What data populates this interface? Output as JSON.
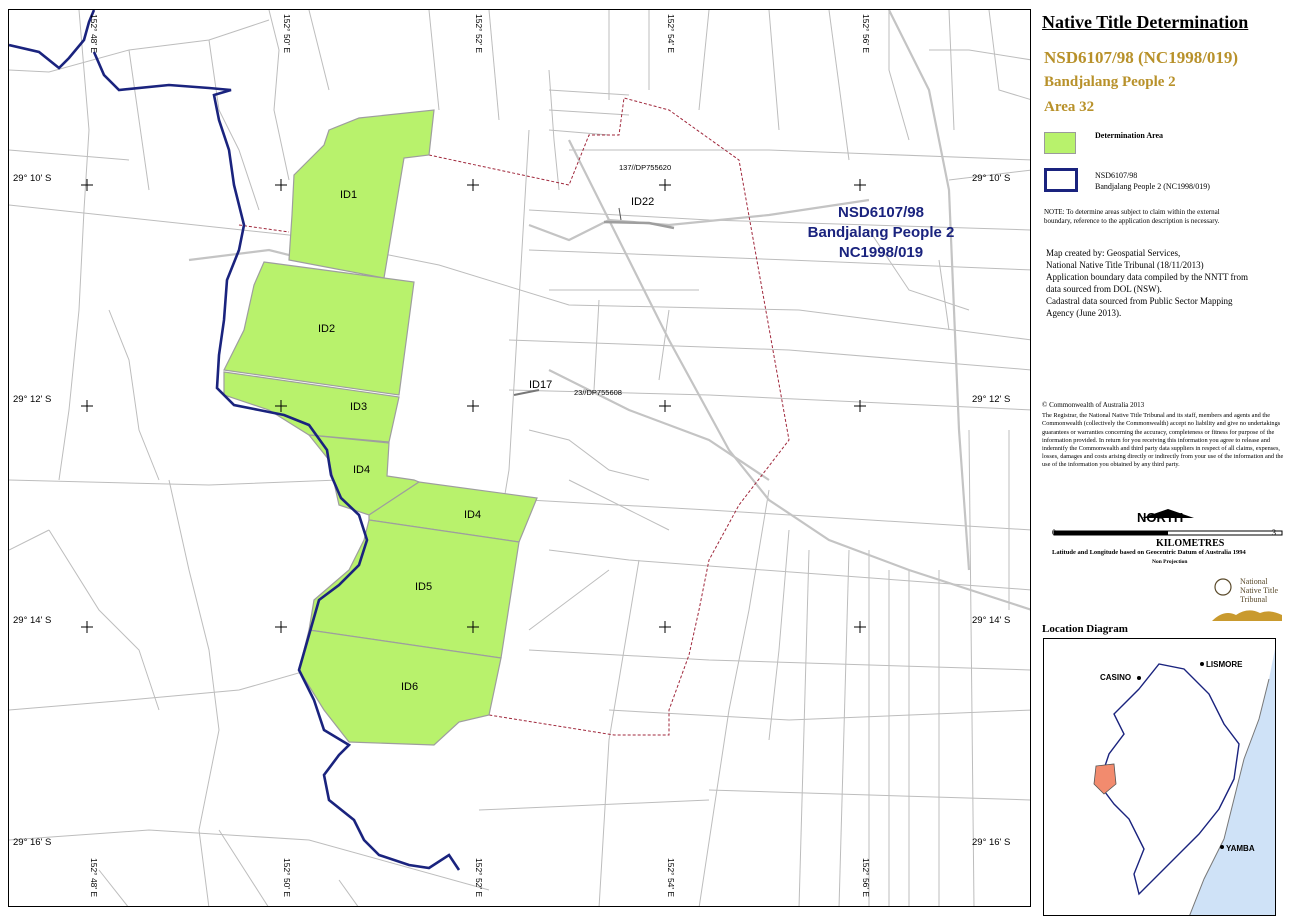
{
  "header": {
    "title": "Native Title Determination",
    "file_number": "NSD6107/98 (NC1998/019)",
    "claim_name": "Bandjalang People 2",
    "area": "Area 32"
  },
  "legend": {
    "determination_area_label": "Determination Area",
    "boundary_label_1": "NSD6107/98",
    "boundary_label_2": "Bandjalang People 2 (NC1998/019)",
    "determination_color": "#b8f26c",
    "boundary_color": "#1a237e"
  },
  "note": {
    "line1": "NOTE: To determine areas subject to claim within the external",
    "line2": "boundary, reference to the application description is necessary."
  },
  "credits": {
    "line1": "Map created by: Geospatial Services,",
    "line2": "National Native Title Tribunal   (18/11/2013)",
    "line3": "Application boundary data compiled by the NNTT from",
    "line4": "data sourced from DOL (NSW).",
    "line5": "Cadastral data sourced from Public Sector Mapping",
    "line6": "Agency (June 2013)."
  },
  "legal": {
    "copyright": "© Commonwealth of Australia 2013",
    "disclaimer": "The Registrar, the National Native Title Tribunal and its staff, members and agents and the Commonwealth (collectively the Commonwealth) accept no liability and give no undertakings guarantees or warranties concerning the accuracy, completeness or fitness for purpose of the information provided. In return for you receiving this information you agree to release and indemnify the Commonwealth and third party data suppliers in respect of all claims, expenses, losses, damages and costs arising directly or indirectly from your use of the information and the use of the information you obtained by any third party."
  },
  "scale": {
    "north": "NORTH",
    "start": "0",
    "end": "3",
    "units": "KILOMETRES",
    "datum": "Latitude and Longitude based on Geocentric Datum of Australia 1994",
    "projection": "Non Projection"
  },
  "nntt_logo": {
    "line1": "National",
    "line2": "Native Title",
    "line3": "Tribunal"
  },
  "location_diagram": {
    "title": "Location Diagram",
    "towns": [
      "LISMORE",
      "CASINO",
      "YAMBA"
    ]
  },
  "map": {
    "claim_label": [
      "NSD6107/98",
      "Bandjalang People 2",
      "NC1998/019"
    ],
    "areas": [
      "ID1",
      "ID2",
      "ID3",
      "ID4",
      "ID4",
      "ID5",
      "ID6"
    ],
    "other_ids": [
      "ID22",
      "ID17"
    ],
    "parcels": [
      "137//DP755620",
      "23//DP755608"
    ],
    "lat_labels": [
      "29° 10' S",
      "29° 12' S",
      "29° 14' S",
      "29° 16' S"
    ],
    "lon_labels": [
      "152° 48' E",
      "152° 50' E",
      "152° 52' E",
      "152° 54' E",
      "152° 56' E"
    ]
  }
}
